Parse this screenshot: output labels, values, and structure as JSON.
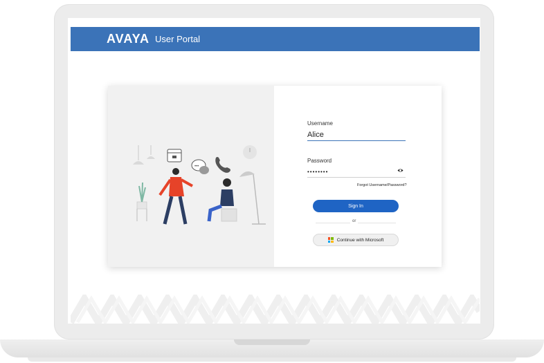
{
  "header": {
    "logo_text": "AVAYA",
    "title": "User Portal"
  },
  "form": {
    "username_label": "Username",
    "username_value": "Alice",
    "password_label": "Password",
    "password_value": "••••••••",
    "forgot_link": "Forgot Username/Password?",
    "signin_label": "Sign In",
    "or_text": "or",
    "microsoft_label": "Continue with Microsoft"
  },
  "colors": {
    "brand_blue": "#3b73b8",
    "button_blue": "#1f64c4",
    "ms_red": "#f25022",
    "ms_green": "#7fba00",
    "ms_blue": "#00a4ef",
    "ms_yellow": "#ffb900"
  },
  "icons": {
    "eye": "eye-icon",
    "microsoft": "microsoft-logo-icon"
  }
}
